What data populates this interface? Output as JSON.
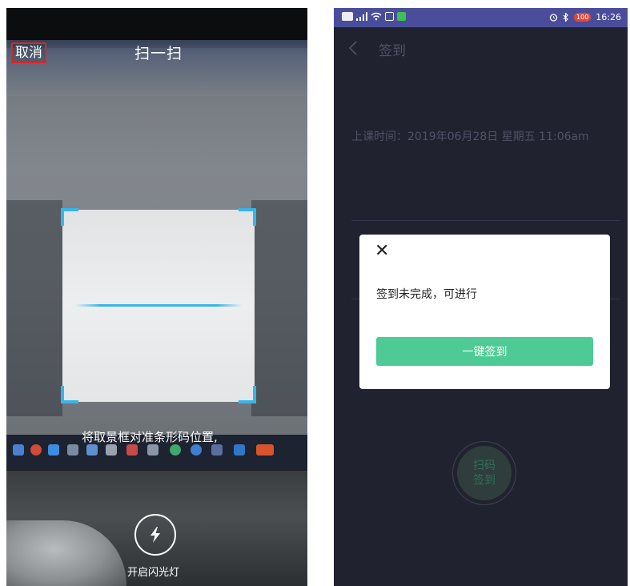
{
  "scanner": {
    "cancel_label": "取消",
    "title": "扫一扫",
    "hint": "将取景框对准条形码位置,",
    "flash_label": "开启闪光灯",
    "flash_icon": "lightning-icon",
    "frame_color": "#38b5e8"
  },
  "app": {
    "status_bar": {
      "time": "16:26",
      "battery": "100"
    },
    "header": {
      "back_icon": "chevron-left-icon",
      "title": "签到"
    },
    "class_time": "上课时间：2019年06月28日  星期五  11:06am",
    "scan_sign": {
      "line1": "扫码",
      "line2": "签到"
    },
    "modal": {
      "close_icon": "close-icon",
      "close_glyph": "✕",
      "message": "签到未完成，可进行",
      "button_label": "一键签到",
      "button_color": "#4ecb94"
    }
  }
}
